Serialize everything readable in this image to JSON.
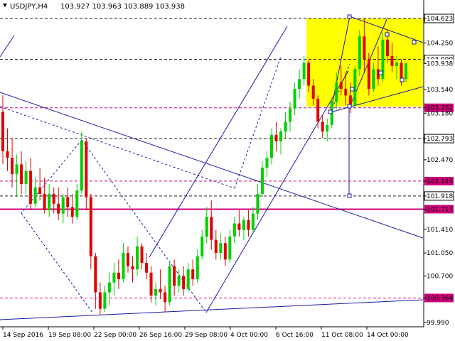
{
  "header": {
    "symbol_text": "USDJPY,H4",
    "ohlc_text": "103.927 103.963 103.889 103.938",
    "collapse_icon": "triangle-down-icon"
  },
  "colors": {
    "background": "#ffffff",
    "bull": "#00d000",
    "bear": "#e00000",
    "trendline": "#1a1aa8",
    "level_line": "#d0007a",
    "highlight": "#ffff00",
    "grid_dash": "#1a1a1a"
  },
  "chart_data": {
    "type": "candlestick",
    "symbol": "USDJPY",
    "timeframe": "H4",
    "ylim": [
      99.99,
      104.75
    ],
    "y_ticks": [
      "104.623",
      "104.250",
      "103.999",
      "103.938",
      "103.540",
      "103.262",
      "103.180",
      "102.793",
      "102.470",
      "102.145",
      "101.918",
      "101.717",
      "101.410",
      "101.050",
      "100.700",
      "100.364",
      "99.990"
    ],
    "x_ticks": [
      "14 Sep 2016",
      "19 Sep 08:00",
      "22 Sep 00:00",
      "26 Sep 16:00",
      "29 Sep 08:00",
      "4 Oct 00:00",
      "6 Oct 16:00",
      "11 Oct 08:00",
      "14 Oct 00:00"
    ],
    "current_price": 103.938,
    "levels": [
      {
        "label": "104.623",
        "value": 104.623,
        "style": "dashed"
      },
      {
        "label": "103.999",
        "value": 103.999,
        "style": "dashed"
      },
      {
        "label": "103.262",
        "value": 103.262,
        "style": "dashed-magenta"
      },
      {
        "label": "102.793",
        "value": 102.793,
        "style": "dashed"
      },
      {
        "label": "102.145",
        "value": 102.145,
        "style": "dashed-magenta"
      },
      {
        "label": "101.918",
        "value": 101.918,
        "style": "dashed"
      },
      {
        "label": "101.717",
        "value": 101.717,
        "style": "solid-magenta"
      },
      {
        "label": "100.364",
        "value": 100.364,
        "style": "dashed-magenta"
      }
    ],
    "candles": [
      [
        103.2,
        103.45,
        102.4,
        102.6
      ],
      [
        102.6,
        102.95,
        102.3,
        102.5
      ],
      [
        102.5,
        102.8,
        102.05,
        102.25
      ],
      [
        102.25,
        102.55,
        101.9,
        102.4
      ],
      [
        102.4,
        102.6,
        101.95,
        102.1
      ],
      [
        102.1,
        102.45,
        101.95,
        102.3
      ],
      [
        102.3,
        102.5,
        101.7,
        101.8
      ],
      [
        101.8,
        102.2,
        101.75,
        102.05
      ],
      [
        102.05,
        102.35,
        101.85,
        101.95
      ],
      [
        101.95,
        102.2,
        101.65,
        101.7
      ],
      [
        101.7,
        102.1,
        101.6,
        101.95
      ],
      [
        101.95,
        102.05,
        101.65,
        101.8
      ],
      [
        101.8,
        102.05,
        101.55,
        101.65
      ],
      [
        101.65,
        101.95,
        101.5,
        101.9
      ],
      [
        101.9,
        102.05,
        101.6,
        101.75
      ],
      [
        101.75,
        101.95,
        101.5,
        101.6
      ],
      [
        101.6,
        102.1,
        101.55,
        102.0
      ],
      [
        102.0,
        102.9,
        101.95,
        102.75
      ],
      [
        102.75,
        102.8,
        101.7,
        101.9
      ],
      [
        101.9,
        101.95,
        100.8,
        101.0
      ],
      [
        101.0,
        101.05,
        100.2,
        100.45
      ],
      [
        100.45,
        100.6,
        100.1,
        100.2
      ],
      [
        100.2,
        100.55,
        100.15,
        100.45
      ],
      [
        100.45,
        100.75,
        100.25,
        100.6
      ],
      [
        100.6,
        100.9,
        100.4,
        100.75
      ],
      [
        100.75,
        100.95,
        100.5,
        100.65
      ],
      [
        100.65,
        101.2,
        100.6,
        101.05
      ],
      [
        101.05,
        101.15,
        100.75,
        100.85
      ],
      [
        100.85,
        101.0,
        100.6,
        100.8
      ],
      [
        100.8,
        101.3,
        100.7,
        101.15
      ],
      [
        101.15,
        101.2,
        100.8,
        100.9
      ],
      [
        100.9,
        101.05,
        100.65,
        100.75
      ],
      [
        100.75,
        100.85,
        100.3,
        100.4
      ],
      [
        100.4,
        100.6,
        100.25,
        100.5
      ],
      [
        100.5,
        100.8,
        100.35,
        100.45
      ],
      [
        100.45,
        100.55,
        100.15,
        100.3
      ],
      [
        100.3,
        100.9,
        100.25,
        100.85
      ],
      [
        100.85,
        100.95,
        100.4,
        100.55
      ],
      [
        100.55,
        100.8,
        100.45,
        100.7
      ],
      [
        100.7,
        100.85,
        100.4,
        100.5
      ],
      [
        100.5,
        100.9,
        100.45,
        100.8
      ],
      [
        100.8,
        100.95,
        100.55,
        100.65
      ],
      [
        100.65,
        101.1,
        100.6,
        101.0
      ],
      [
        101.0,
        101.4,
        100.95,
        101.3
      ],
      [
        101.3,
        101.75,
        101.2,
        101.6
      ],
      [
        101.6,
        101.85,
        101.1,
        101.25
      ],
      [
        101.25,
        101.4,
        100.95,
        101.05
      ],
      [
        101.05,
        101.35,
        100.95,
        101.2
      ],
      [
        101.2,
        101.3,
        100.85,
        100.95
      ],
      [
        100.95,
        101.4,
        100.9,
        101.3
      ],
      [
        101.3,
        101.6,
        101.2,
        101.5
      ],
      [
        101.5,
        101.7,
        101.3,
        101.4
      ],
      [
        101.4,
        101.6,
        101.25,
        101.55
      ],
      [
        101.55,
        101.7,
        101.3,
        101.4
      ],
      [
        101.4,
        101.75,
        101.35,
        101.65
      ],
      [
        101.65,
        102.1,
        101.55,
        101.95
      ],
      [
        101.95,
        102.45,
        101.9,
        102.35
      ],
      [
        102.35,
        102.6,
        102.2,
        102.5
      ],
      [
        102.5,
        102.95,
        102.4,
        102.85
      ],
      [
        102.85,
        103.05,
        102.6,
        102.75
      ],
      [
        102.75,
        102.95,
        102.55,
        102.9
      ],
      [
        102.9,
        103.2,
        102.8,
        103.05
      ],
      [
        103.05,
        103.35,
        102.9,
        103.25
      ],
      [
        103.25,
        103.65,
        103.15,
        103.55
      ],
      [
        103.55,
        103.85,
        103.4,
        103.7
      ],
      [
        103.7,
        104.05,
        103.6,
        103.95
      ],
      [
        103.95,
        103.98,
        103.5,
        103.6
      ],
      [
        103.6,
        103.7,
        103.3,
        103.4
      ],
      [
        103.4,
        103.45,
        102.95,
        103.05
      ],
      [
        103.05,
        103.15,
        102.8,
        102.9
      ],
      [
        102.9,
        103.1,
        102.75,
        103.0
      ],
      [
        103.0,
        103.4,
        102.95,
        103.35
      ],
      [
        103.35,
        103.8,
        103.25,
        103.65
      ],
      [
        103.65,
        103.9,
        103.45,
        103.55
      ],
      [
        103.55,
        103.8,
        103.3,
        103.45
      ],
      [
        103.45,
        103.65,
        103.18,
        103.3
      ],
      [
        103.3,
        103.9,
        103.25,
        103.85
      ],
      [
        103.85,
        104.45,
        103.75,
        104.35
      ],
      [
        104.35,
        104.62,
        103.8,
        104.0
      ],
      [
        104.0,
        104.1,
        103.45,
        103.55
      ],
      [
        103.55,
        103.95,
        103.5,
        103.85
      ],
      [
        103.85,
        104.2,
        103.6,
        103.7
      ],
      [
        103.7,
        104.4,
        103.65,
        104.3
      ],
      [
        104.3,
        104.45,
        103.95,
        104.05
      ],
      [
        104.05,
        104.25,
        103.8,
        103.9
      ],
      [
        103.9,
        104.05,
        103.7,
        103.95
      ],
      [
        103.95,
        104.0,
        103.6,
        103.7
      ],
      [
        103.7,
        103.95,
        103.65,
        103.94
      ]
    ]
  }
}
